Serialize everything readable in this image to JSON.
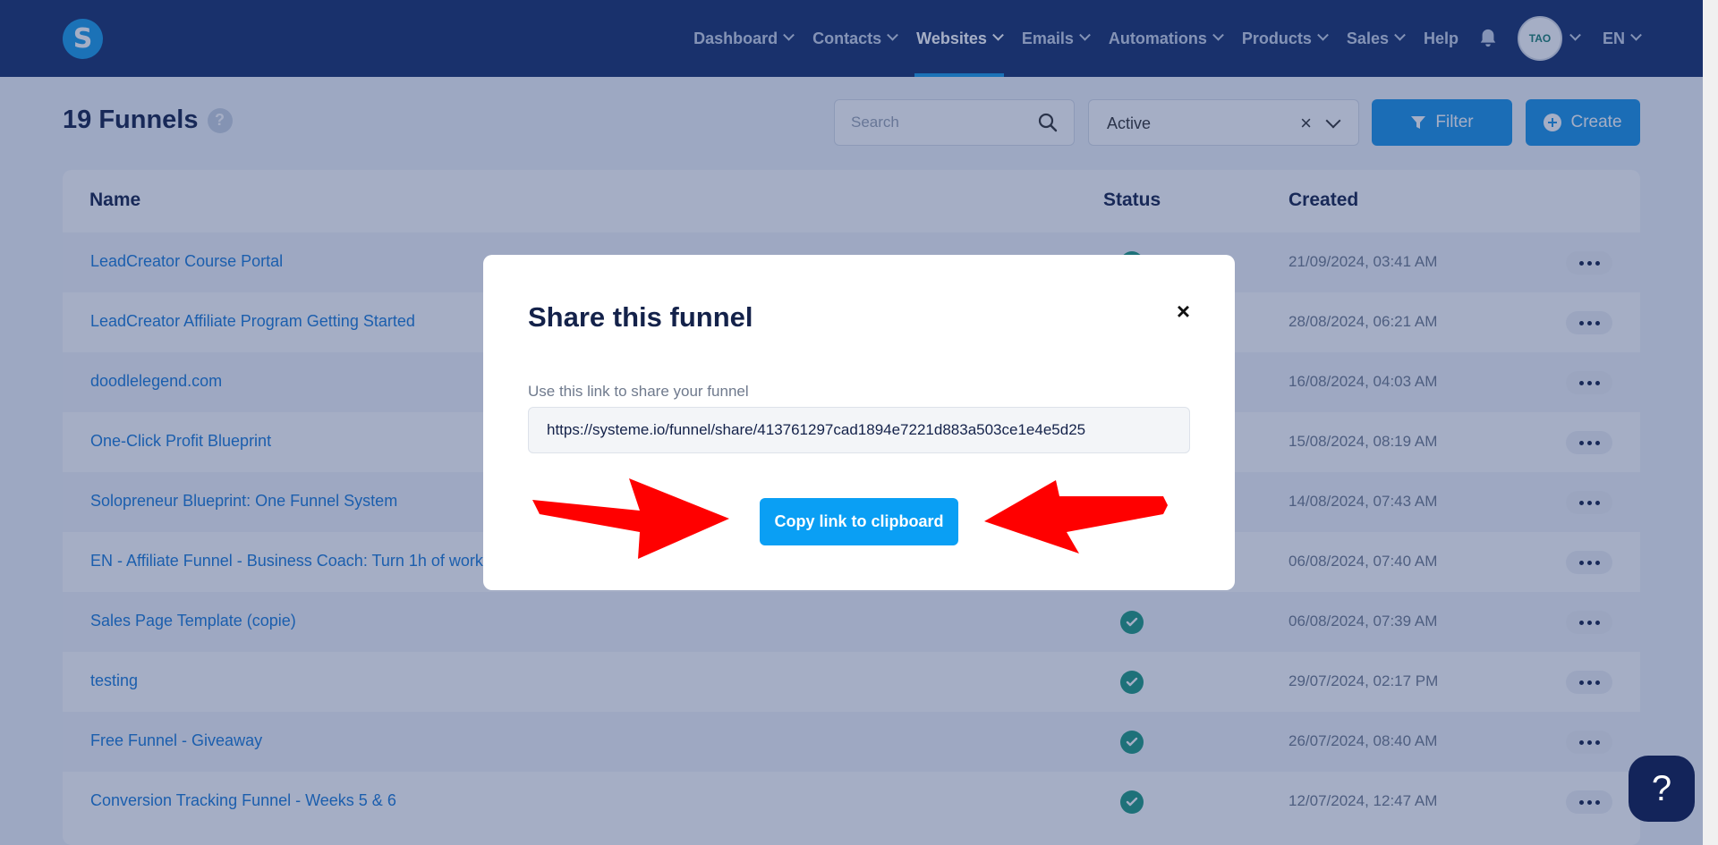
{
  "nav": {
    "logo_letter": "S",
    "items": [
      {
        "label": "Dashboard",
        "chevron": true
      },
      {
        "label": "Contacts",
        "chevron": true
      },
      {
        "label": "Websites",
        "chevron": true,
        "active": true
      },
      {
        "label": "Emails",
        "chevron": true
      },
      {
        "label": "Automations",
        "chevron": true
      },
      {
        "label": "Products",
        "chevron": true
      },
      {
        "label": "Sales",
        "chevron": true
      },
      {
        "label": "Help",
        "chevron": false
      }
    ],
    "avatar_text": "TAO",
    "language": "EN"
  },
  "page": {
    "title": "19 Funnels",
    "help_icon": "?",
    "search_placeholder": "Search",
    "status_filter_value": "Active",
    "status_clear_icon": "×",
    "filter_label": "Filter",
    "create_label": "Create"
  },
  "table": {
    "headers": {
      "name": "Name",
      "status": "Status",
      "created": "Created"
    },
    "rows": [
      {
        "name": "LeadCreator Course Portal",
        "created": "21/09/2024, 03:41 AM"
      },
      {
        "name": "LeadCreator Affiliate Program Getting Started",
        "created": "28/08/2024, 06:21 AM"
      },
      {
        "name": "doodlelegend.com",
        "created": "16/08/2024, 04:03 AM"
      },
      {
        "name": "One-Click Profit Blueprint",
        "created": "15/08/2024, 08:19 AM"
      },
      {
        "name": "Solopreneur Blueprint: One Funnel System",
        "created": "14/08/2024, 07:43 AM"
      },
      {
        "name": "EN - Affiliate Funnel - Business Coach: Turn 1h of work",
        "created": "06/08/2024, 07:40 AM"
      },
      {
        "name": "Sales Page Template (copie)",
        "created": "06/08/2024, 07:39 AM"
      },
      {
        "name": "testing",
        "created": "29/07/2024, 02:17 PM"
      },
      {
        "name": "Free Funnel - Giveaway",
        "created": "26/07/2024, 08:40 AM"
      },
      {
        "name": "Conversion Tracking Funnel - Weeks 5 & 6",
        "created": "12/07/2024, 12:47 AM"
      }
    ]
  },
  "modal": {
    "title": "Share this funnel",
    "close_icon": "×",
    "label": "Use this link to share your funnel",
    "share_url": "https://systeme.io/funnel/share/413761297cad1894e7221d883a503ce1e4e5d25",
    "copy_button": "Copy link to clipboard"
  },
  "help_float": "?",
  "colors": {
    "nav_bg": "#16306b",
    "accent": "#1a93e6",
    "copy_button": "#0a9ff4",
    "status_active": "#1e9a80",
    "annotation_arrow": "#ff0000"
  }
}
